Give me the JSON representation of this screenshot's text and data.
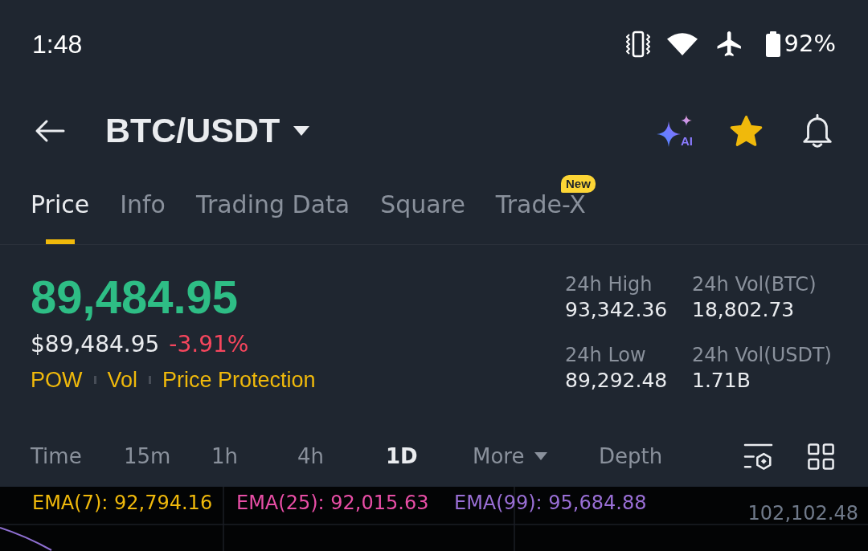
{
  "status_bar": {
    "time": "1:48",
    "battery": "92%"
  },
  "header": {
    "pair": "BTC/USDT",
    "assistant_label": "AI",
    "favorited": true
  },
  "tabs": [
    {
      "label": "Price",
      "selected": true
    },
    {
      "label": "Info",
      "selected": false
    },
    {
      "label": "Trading Data",
      "selected": false
    },
    {
      "label": "Square",
      "selected": false
    },
    {
      "label": "Trade-X",
      "selected": false,
      "badge": "New"
    }
  ],
  "ticker": {
    "last_price": "89,484.95",
    "fiat_price": "$89,484.95",
    "change": "-3.91%",
    "tags": [
      "POW",
      "Vol",
      "Price Protection"
    ]
  },
  "stats": [
    {
      "label": "24h High",
      "value": "93,342.36"
    },
    {
      "label": "24h Vol(BTC)",
      "value": "18,802.73"
    },
    {
      "label": "24h Low",
      "value": "89,292.48"
    },
    {
      "label": "24h Vol(USDT)",
      "value": "1.71B"
    }
  ],
  "intervals": [
    {
      "label": "Time",
      "kind": "option",
      "selected": false
    },
    {
      "label": "15m",
      "kind": "option",
      "selected": false
    },
    {
      "label": "1h",
      "kind": "option",
      "selected": false
    },
    {
      "label": "4h",
      "kind": "option",
      "selected": false
    },
    {
      "label": "1D",
      "kind": "option",
      "selected": true
    },
    {
      "label": "More",
      "kind": "menu",
      "selected": false
    },
    {
      "label": "Depth",
      "kind": "option",
      "selected": false
    }
  ],
  "chart": {
    "indicators": [
      {
        "label": "EMA(7): 92,794.16",
        "color": "#f0b90b"
      },
      {
        "label": "EMA(25): 92,015.63",
        "color": "#e84ea6"
      },
      {
        "label": "EMA(99): 95,684.88",
        "color": "#9a6fd6"
      }
    ],
    "price_label": "102,102.48"
  }
}
